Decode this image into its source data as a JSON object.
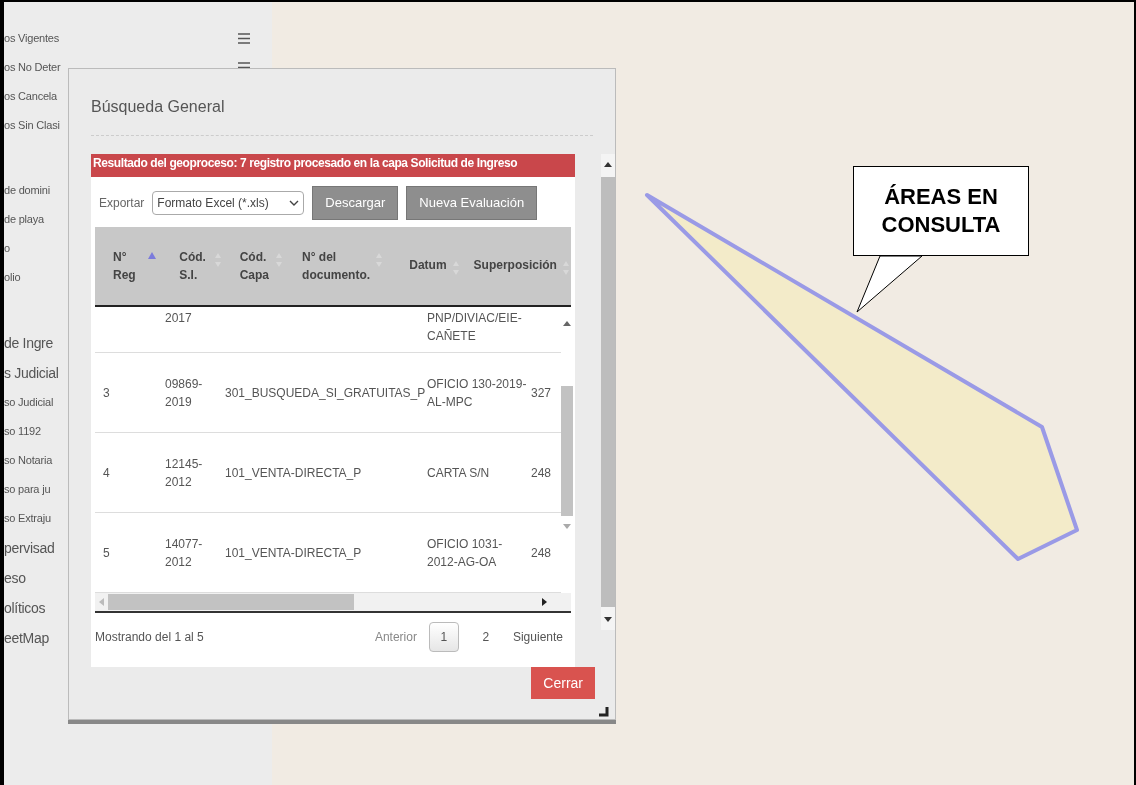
{
  "sidebar": {
    "groups": [
      {
        "items": [
          {
            "label": "os Vigentes",
            "kind": "layer"
          },
          {
            "label": "os No Deter",
            "kind": "layer"
          },
          {
            "label": "os Cancela",
            "kind": "small"
          },
          {
            "label": "os Sin Clasi",
            "kind": "small"
          }
        ]
      },
      {
        "items": [
          {
            "label": "de domini",
            "kind": "small"
          },
          {
            "label": "de playa",
            "kind": "small"
          },
          {
            "label": "o",
            "kind": "small"
          },
          {
            "label": "olio",
            "kind": "small"
          }
        ]
      },
      {
        "items": [
          {
            "label": "de Ingre",
            "kind": "large"
          },
          {
            "label": "s Judicial",
            "kind": "large"
          },
          {
            "label": "so Judicial",
            "kind": "small"
          },
          {
            "label": "so 1192",
            "kind": "small"
          },
          {
            "label": "so Notaria",
            "kind": "small"
          },
          {
            "label": "so para ju",
            "kind": "small"
          },
          {
            "label": "so Extraju",
            "kind": "small"
          },
          {
            "label": "pervisad",
            "kind": "large"
          },
          {
            "label": "eso",
            "kind": "large"
          },
          {
            "label": "olíticos",
            "kind": "large"
          },
          {
            "label": "eetMap",
            "kind": "large"
          }
        ]
      }
    ]
  },
  "dialog": {
    "title": "Búsqueda General",
    "result_banner": "Resultado del geoproceso: 7 registro procesado en la capa Solicitud de Ingreso",
    "export": {
      "label": "Exportar",
      "format": "Formato Excel (*.xls)",
      "buttons": [
        "Descargar",
        "Nueva Evaluación"
      ]
    },
    "table": {
      "columns": [
        {
          "label": "N° Reg",
          "sorted": true
        },
        {
          "label": "Cód. S.I.",
          "sorted": false
        },
        {
          "label": "Cód. Capa",
          "sorted": false
        },
        {
          "label": "N° del documento.",
          "sorted": false
        },
        {
          "label": "Datum",
          "sorted": false
        },
        {
          "label": "Superposición",
          "sorted": false
        }
      ],
      "rows": [
        {
          "partial": true,
          "no": "",
          "cod_si": "2017",
          "cod_capa": "",
          "documento": "PNP/DIVIAC/EIE-CAÑETE",
          "superposicion": ""
        },
        {
          "partial": false,
          "no": "3",
          "cod_si": "09869-2019",
          "cod_capa": "301_BUSQUEDA_SI_GRATUITAS_P",
          "documento": "OFICIO 130-2019-AL-MPC",
          "superposicion": "327"
        },
        {
          "partial": false,
          "no": "4",
          "cod_si": "12145-2012",
          "cod_capa": "101_VENTA-DIRECTA_P",
          "documento": "CARTA S/N",
          "superposicion": "248"
        },
        {
          "partial": false,
          "no": "5",
          "cod_si": "14077-2012",
          "cod_capa": "101_VENTA-DIRECTA_P",
          "documento": "OFICIO 1031-2012-AG-OA",
          "superposicion": "248"
        }
      ]
    },
    "footer": {
      "info": "Mostrando del 1 al 5",
      "previous": "Anterior",
      "pages": [
        {
          "label": "1",
          "selected": true
        },
        {
          "label": "2",
          "selected": false
        }
      ],
      "next": "Siguiente"
    },
    "close_button": "Cerrar"
  },
  "callout": {
    "text": "ÁREAS EN CONSULTA"
  }
}
